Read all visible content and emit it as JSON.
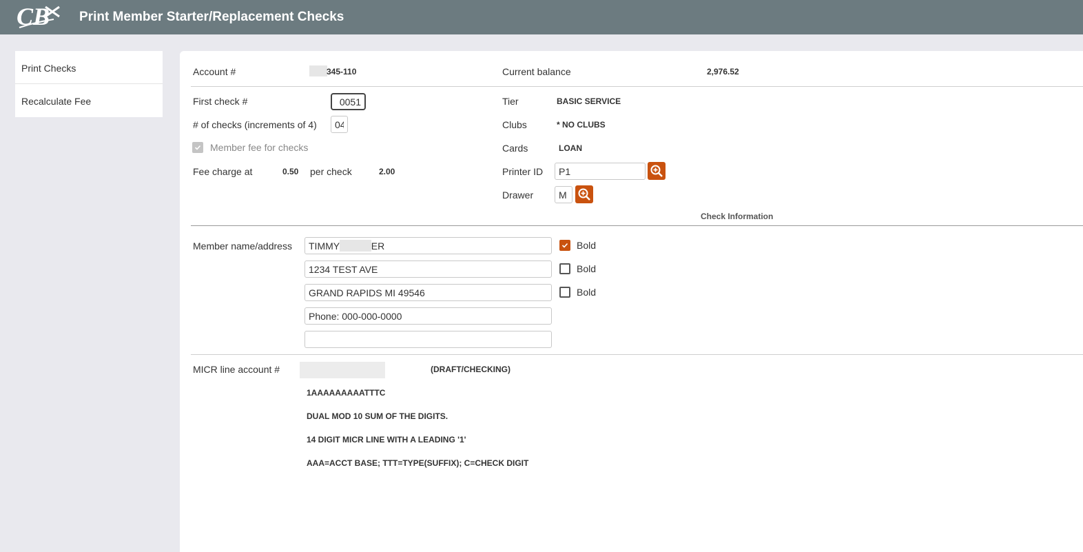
{
  "app": {
    "title": "Print Member Starter/Replacement Checks",
    "logo_text": "CB"
  },
  "sidebar": {
    "items": [
      {
        "label": "Print Checks"
      },
      {
        "label": "Recalculate Fee"
      }
    ]
  },
  "account": {
    "label": "Account #",
    "value": "345-110",
    "balance_label": "Current balance",
    "balance_value": "2,976.52"
  },
  "checks": {
    "first_label": "First check #",
    "first_value": "0051",
    "count_label": "# of checks (increments of 4)",
    "count_value": "04",
    "member_fee_label": "Member fee for checks",
    "member_fee_checked": true,
    "fee_label": "Fee charge at",
    "fee_rate": "0.50",
    "per_check_label": "per check",
    "fee_total": "2.00"
  },
  "member_info": {
    "tier_label": "Tier",
    "tier_value": "BASIC SERVICE",
    "clubs_label": "Clubs",
    "clubs_value": "* NO CLUBS",
    "cards_label": "Cards",
    "cards_value": "LOAN",
    "printer_label": "Printer ID",
    "printer_value": "P1",
    "drawer_label": "Drawer",
    "drawer_value": "M"
  },
  "section_title": "Check Information",
  "address": {
    "label": "Member name/address",
    "bold_label": "Bold",
    "lines": [
      {
        "value": "TIMMY MEMBER",
        "bold": true
      },
      {
        "value": "1234 TEST AVE",
        "bold": false
      },
      {
        "value": "GRAND RAPIDS MI 49546",
        "bold": false
      },
      {
        "value": "Phone: 000-000-0000"
      },
      {
        "value": ""
      }
    ]
  },
  "micr": {
    "label": "MICR line account #",
    "type": "(DRAFT/CHECKING)",
    "notes": [
      "1AAAAAAAAATTTC",
      "DUAL MOD 10 SUM OF THE DIGITS.",
      "14 DIGIT MICR LINE WITH A LEADING '1'",
      "AAA=ACCT BASE; TTT=TYPE(SUFFIX); C=CHECK DIGIT"
    ]
  },
  "colors": {
    "topbar": "#6c7b80",
    "accent": "#c9520f",
    "background": "#e9e9ee"
  }
}
